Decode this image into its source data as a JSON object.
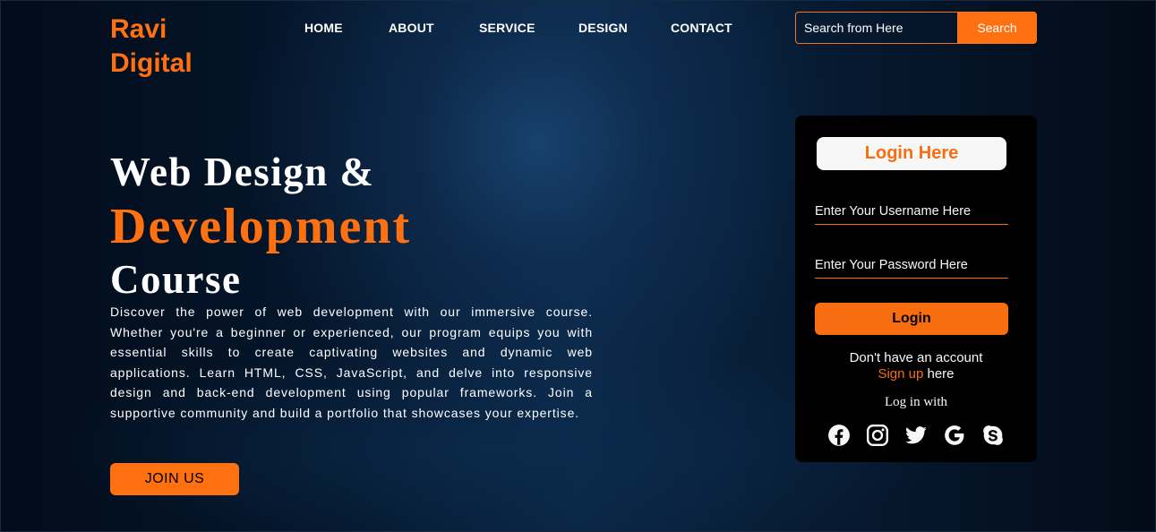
{
  "brand": {
    "line1": "Ravi",
    "line2": "Digital"
  },
  "nav": {
    "items": [
      {
        "label": "HOME"
      },
      {
        "label": "ABOUT"
      },
      {
        "label": "SERVICE"
      },
      {
        "label": "DESIGN"
      },
      {
        "label": "CONTACT"
      }
    ]
  },
  "search": {
    "placeholder": "Search from Here",
    "value": "",
    "button_label": "Search"
  },
  "hero": {
    "title_line1": "Web Design &",
    "title_line2": "Development",
    "title_line3": "Course",
    "description": "Discover the power of web development with our immersive course. Whether you're a beginner or experienced, our program equips you with essential skills to create captivating websites and dynamic web applications. Learn HTML, CSS, JavaScript, and delve into responsive design and back-end development using popular frameworks. Join a supportive community and build a portfolio that showcases your expertise.",
    "join_label": "JOIN US"
  },
  "login": {
    "title": "Login Here",
    "username_placeholder": "Enter Your Username Here",
    "password_placeholder": "Enter Your Password Here",
    "button_label": "Login",
    "no_account_text": "Don't have an account",
    "signup_link": "Sign up",
    "signup_suffix": " here",
    "login_with": "Log in with",
    "socials": [
      {
        "icon": "facebook-icon"
      },
      {
        "icon": "instagram-icon"
      },
      {
        "icon": "twitter-icon"
      },
      {
        "icon": "google-icon"
      },
      {
        "icon": "skype-icon"
      }
    ]
  },
  "colors": {
    "accent": "#ff7010",
    "background": "#05172d",
    "card": "#000000"
  }
}
